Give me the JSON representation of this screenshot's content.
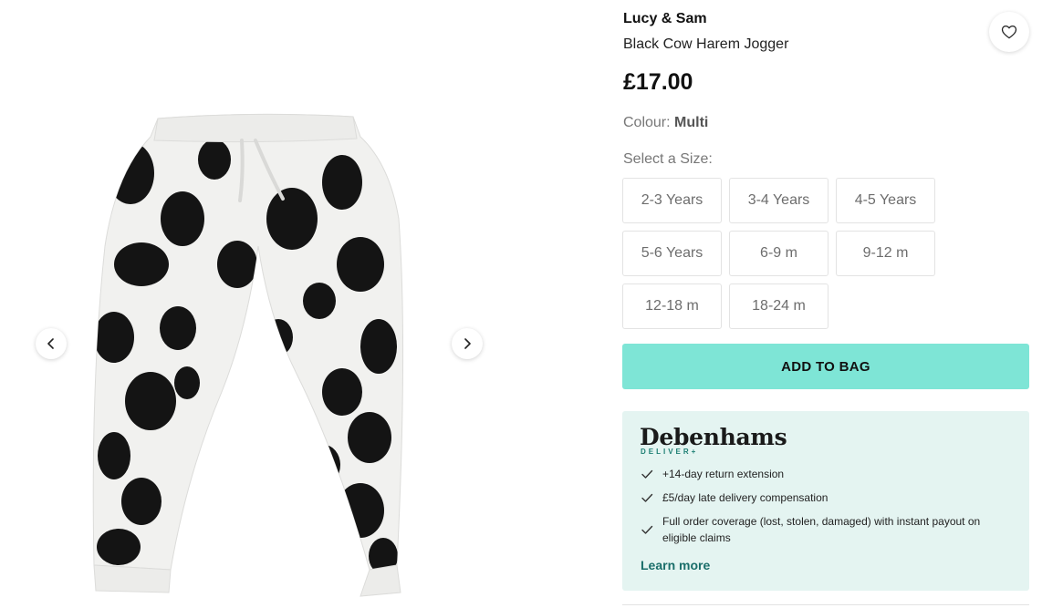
{
  "gallery": {
    "prev_icon": "chevron-left-icon",
    "next_icon": "chevron-right-icon"
  },
  "product": {
    "brand": "Lucy & Sam",
    "name": "Black Cow Harem Jogger",
    "price": "£17.00",
    "colour_label": "Colour:",
    "colour_value": "Multi",
    "wishlist_icon": "heart-icon"
  },
  "sizes": {
    "title": "Select a Size:",
    "options": [
      "2-3 Years",
      "3-4 Years",
      "4-5 Years",
      "5-6 Years",
      "6-9 m",
      "9-12 m",
      "12-18 m",
      "18-24 m"
    ]
  },
  "cart": {
    "add_label": "ADD TO BAG"
  },
  "deliver": {
    "logo": "Debenhams",
    "sub": "DELIVER+",
    "benefits": [
      "+14-day return extension",
      "£5/day late delivery compensation",
      "Full order coverage (lost, stolen, damaged) with instant payout on eligible claims"
    ],
    "learn_more": "Learn more",
    "check_icon": "check-icon",
    "accent": "#7ee5d6",
    "card_bg": "#e4f4f1"
  }
}
